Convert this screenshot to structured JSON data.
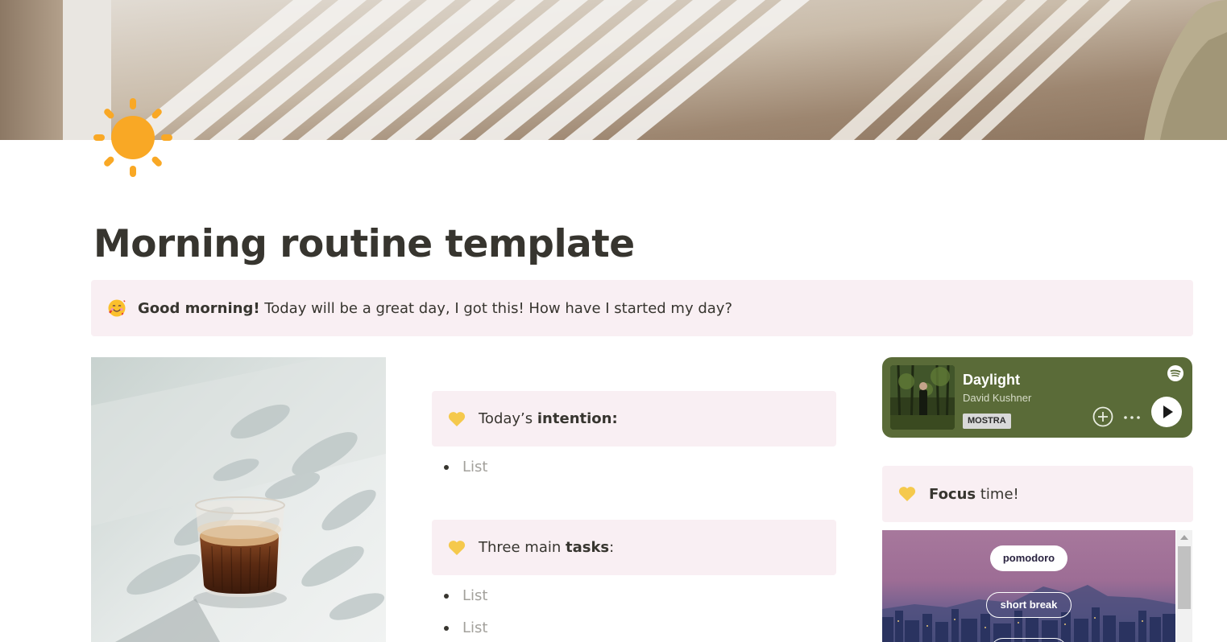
{
  "page": {
    "title": "Morning routine template",
    "icon": "sun-icon"
  },
  "intro_callout": {
    "icon": "smiling-face-with-hearts-icon",
    "bold": "Good morning!",
    "text": " Today will be a great day, I got this! How have I started my day?"
  },
  "intention_callout": {
    "icon": "yellow-heart-icon",
    "prefix": "Today’s ",
    "bold": "intention:"
  },
  "intention_list": [
    "List"
  ],
  "tasks_callout": {
    "icon": "yellow-heart-icon",
    "prefix": "Three main ",
    "bold": "tasks",
    "suffix": ":"
  },
  "tasks_list": [
    "List",
    "List"
  ],
  "spotify": {
    "track": "Daylight",
    "artist": "David Kushner",
    "badge": "MOSTRA",
    "background": "#5a6b38"
  },
  "focus_callout": {
    "icon": "yellow-heart-icon",
    "bold": "Focus",
    "suffix": " time!"
  },
  "pomodoro": {
    "modes": [
      "pomodoro",
      "short break"
    ],
    "active_mode": "pomodoro"
  },
  "colors": {
    "callout_bg": "#f9eff3",
    "text": "#37352f",
    "placeholder": "#a3a19c",
    "sun": "#f9a825",
    "heart": "#f5c94c"
  }
}
